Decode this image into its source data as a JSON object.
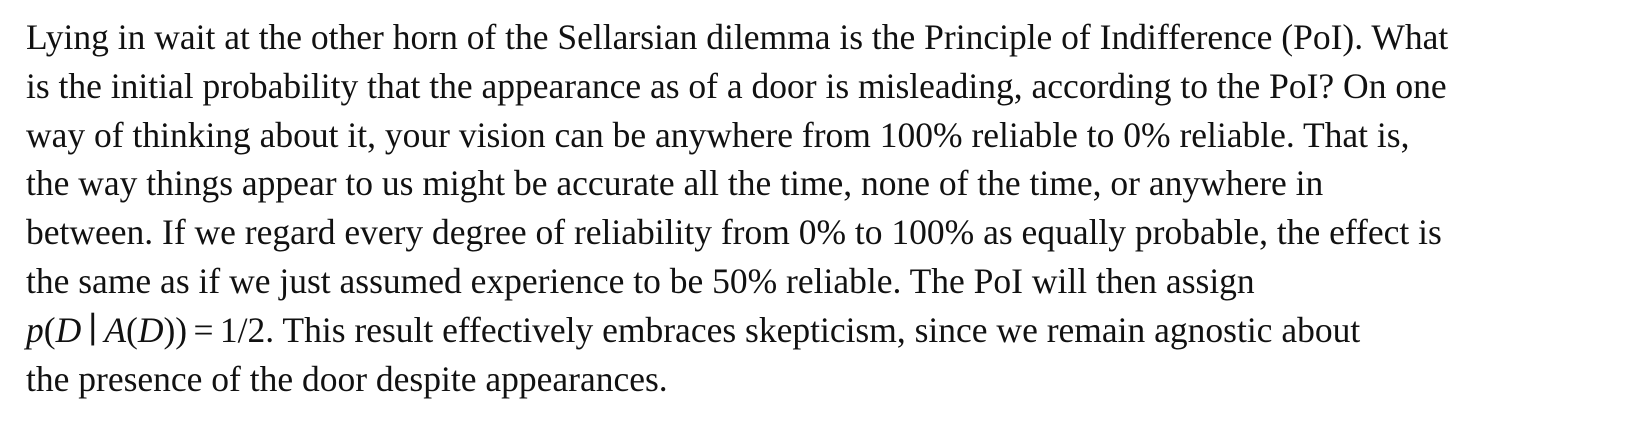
{
  "paragraph": {
    "lines": [
      "Lying in wait at the other horn of the Sellarsian dilemma is the Principle of Indifference (PoI). What",
      "is the initial probability that the appearance as of a door is misleading, according to the PoI? On one",
      "way of thinking about it, your vision can be anywhere from 100% reliable to 0% reliable. That is,",
      "the way things appear to us might be accurate all the time, none of the time, or anywhere in",
      "between. If we regard every degree of reliability from 0% to 100% as equally probable, the effect is",
      "the same as if we just assumed experience to be 50% reliable. The PoI will then assign"
    ],
    "formula": {
      "p": "p",
      "open1": "(",
      "D1": "D",
      "bar": "∣",
      "A": "A",
      "open2": "(",
      "D2": "D",
      "close": "))",
      "eq": "=",
      "value": "1/2"
    },
    "line7_rest": ". This result effectively embraces skepticism, since we remain agnostic about",
    "line8": "the presence of the door despite appearances."
  }
}
